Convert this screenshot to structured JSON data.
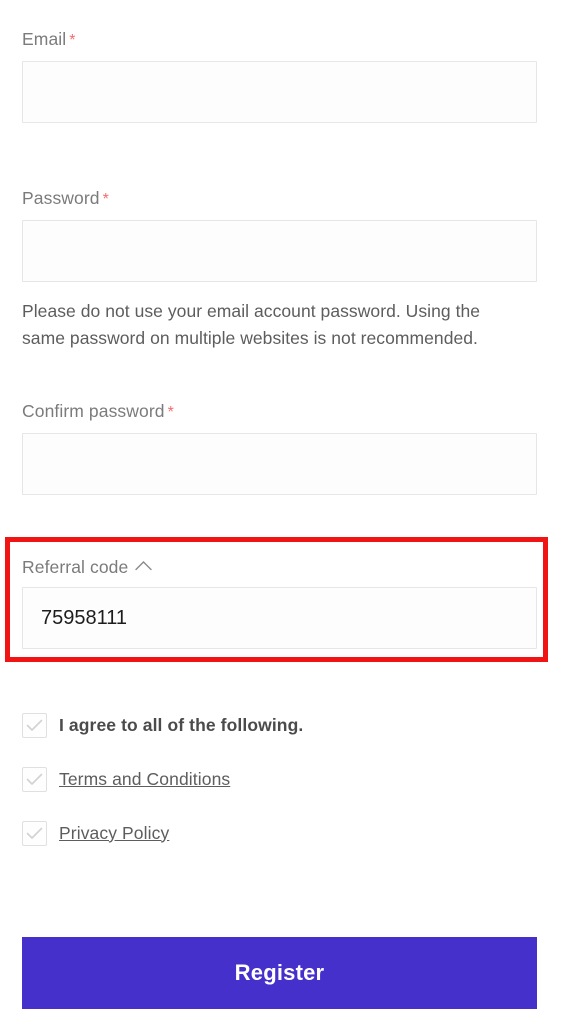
{
  "form": {
    "fields": [
      {
        "key": "email",
        "label": "Email",
        "required_marker": "*",
        "value": "",
        "placeholder": ""
      },
      {
        "key": "password",
        "label": "Password",
        "required_marker": "*",
        "value": "",
        "placeholder": "",
        "help_text": "Please do not use your email account password. Using the same password on multiple websites is not recommended."
      },
      {
        "key": "confirm_password",
        "label": "Confirm password",
        "required_marker": "*",
        "value": "",
        "placeholder": ""
      },
      {
        "key": "referral_code",
        "label": "Referral code",
        "toggle_icon": "chevron-up-icon",
        "value": "75958111",
        "placeholder": ""
      }
    ],
    "agreements": [
      {
        "key": "agree-all",
        "label": "I agree to all of the following.",
        "checked": false,
        "is_link": false,
        "check_icon": "check-icon"
      },
      {
        "key": "terms",
        "label": "Terms and Conditions",
        "checked": false,
        "is_link": true,
        "check_icon": "check-icon"
      },
      {
        "key": "privacy",
        "label": "Privacy Policy",
        "checked": false,
        "is_link": true,
        "check_icon": "check-icon"
      }
    ],
    "submit_label": "Register"
  },
  "highlight": {
    "target": "referral_code",
    "color": "#f01414"
  },
  "colors": {
    "accent": "#4630cc",
    "required_star": "#f26d6d",
    "label": "#7b7b7b",
    "text": "#4b4b4b",
    "input_border": "#e6e6e6",
    "highlight": "#f01414"
  }
}
